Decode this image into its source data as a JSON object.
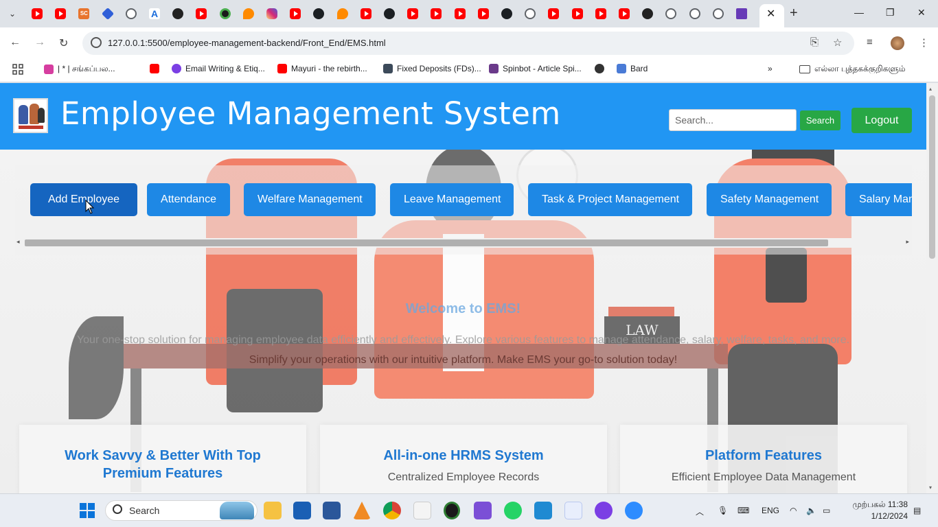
{
  "browser": {
    "active_tab_close": "✕",
    "new_tab": "+",
    "url": "127.0.0.1:5500/employee-management-backend/Front_End/EMS.html",
    "tab_icons": [
      "yt",
      "yt",
      "sc",
      "blue",
      "globe",
      "a",
      "dark",
      "yt",
      "green",
      "orange",
      "insta",
      "yt",
      "gh",
      "orange",
      "yt",
      "gh",
      "yt",
      "yt",
      "yt",
      "yt",
      "gh",
      "globe",
      "yt",
      "yt",
      "yt",
      "yt",
      "dark",
      "globe",
      "globe",
      "globe",
      "form"
    ],
    "bookmarks": [
      {
        "label": "| * | சங்கப்பல...",
        "icon": "pink-square-icon",
        "color": "#d63ea0"
      },
      {
        "label": "",
        "icon": "youtube-icon",
        "color": "#ff0000"
      },
      {
        "label": "Email Writing & Etiq...",
        "icon": "purple-circle-icon",
        "color": "#7b3fe4"
      },
      {
        "label": "Mayuri - the rebirth...",
        "icon": "youtube-icon",
        "color": "#ff0000"
      },
      {
        "label": "Fixed Deposits (FDs)...",
        "icon": "ab-icon",
        "color": "#3c4a5a"
      },
      {
        "label": "Spinbot - Article Spi...",
        "icon": "spinbot-icon",
        "color": "#6a3a8a"
      },
      {
        "label": "",
        "icon": "globe-icon",
        "color": "#333333"
      },
      {
        "label": "Bard",
        "icon": "bard-sparkle-icon",
        "color": "#4a7bd6"
      }
    ],
    "bookmarks_more": "»",
    "bookmarks_folder": "எல்லா புத்தகக்குறிகளும்"
  },
  "site": {
    "title": "Employee Management System",
    "search_placeholder": "Search...",
    "search_button": "Search",
    "logout_button": "Logout",
    "nav": [
      "Add Employee",
      "Attendance",
      "Welfare Management",
      "Leave Management",
      "Task & Project Management",
      "Safety Management",
      "Salary Management"
    ],
    "welcome": "Welcome to EMS!",
    "tagline": "Your one-stop solution for managing employee data efficiently and effectively. Explore various features to manage attendance, salary, welfare, tasks, and more.",
    "tagline2": "Simplify your operations with our intuitive platform. Make EMS your go-to solution today!",
    "law_book": "LAW",
    "cards": [
      {
        "title": "Work Savvy & Better With Top Premium Features",
        "text": ""
      },
      {
        "title": "All-in-one HRMS System",
        "text": "Centralized Employee Records"
      },
      {
        "title": "Platform Features",
        "text": "Efficient Employee Data Management"
      }
    ]
  },
  "taskbar": {
    "search": "Search",
    "lang": "ENG",
    "time": "முற்பகல் 11:38",
    "date": "1/12/2024"
  },
  "colors": {
    "header_blue": "#2196f3",
    "nav_button": "#1e88e5",
    "green_button": "#28a745",
    "card_title": "#1f78d1"
  }
}
